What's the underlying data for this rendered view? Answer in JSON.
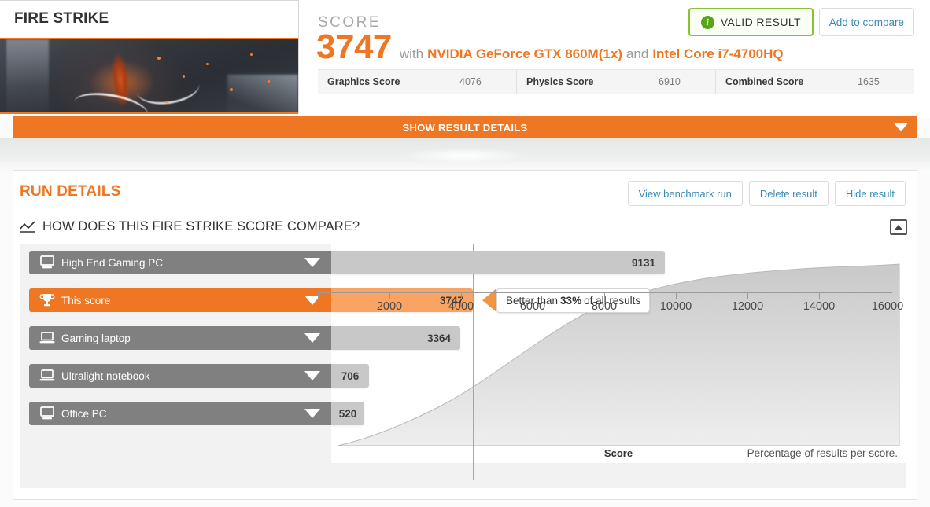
{
  "benchmark": {
    "title": "FIRE STRIKE"
  },
  "score_panel": {
    "label": "SCORE",
    "value": "3747",
    "with_word": "with",
    "gpu": "NVIDIA GeForce GTX 860M(1x)",
    "and_word": "and",
    "cpu": "Intel Core i7-4700HQ",
    "subscores": [
      {
        "name": "Graphics Score",
        "value": "4076"
      },
      {
        "name": "Physics Score",
        "value": "6910"
      },
      {
        "name": "Combined Score",
        "value": "1635"
      }
    ],
    "valid_button": "VALID RESULT",
    "valid_icon": "info-circle-icon",
    "compare_button": "Add to compare"
  },
  "show_details_bar": {
    "label": "SHOW RESULT DETAILS",
    "icon": "chevron-down-icon"
  },
  "run_details": {
    "title": "RUN DETAILS",
    "buttons": [
      {
        "label": "View benchmark run"
      },
      {
        "label": "Delete result"
      },
      {
        "label": "Hide result"
      }
    ],
    "compare_heading": "HOW DOES THIS FIRE STRIKE SCORE COMPARE?",
    "compare_icon": "line-chart-icon",
    "collapse_icon": "chevron-up-icon"
  },
  "tooltip": {
    "prefix": "Better than ",
    "percent": "33%",
    "suffix": " of all results"
  },
  "chart_data": {
    "type": "bar",
    "title": "HOW DOES THIS FIRE STRIKE SCORE COMPARE?",
    "xlabel": "Score",
    "ylabel": "",
    "xlim": [
      0,
      16000
    ],
    "xticks": [
      2000,
      4000,
      6000,
      8000,
      10000,
      12000,
      14000,
      16000
    ],
    "grid": false,
    "annotation": "Percentage of results per score.",
    "categories": [
      "High End Gaming PC",
      "This score",
      "Gaming laptop",
      "Ultralight notebook",
      "Office PC"
    ],
    "values": [
      9131,
      3747,
      3364,
      706,
      520
    ],
    "icons": [
      "desktop-icon",
      "trophy-icon",
      "laptop-icon",
      "laptop-icon",
      "desktop-icon"
    ],
    "highlight_index": 1,
    "marker_value": 3747,
    "percentile": 33,
    "overlay": {
      "type": "area",
      "name": "Percentage of results per score",
      "x": [
        0,
        1000,
        2000,
        3000,
        4000,
        5000,
        6000,
        7000,
        8000,
        9000,
        10000,
        11000,
        12000,
        13000,
        14000,
        15000,
        16000
      ],
      "y": [
        0,
        3,
        9,
        19,
        33,
        48,
        62,
        74,
        83,
        89,
        93,
        96,
        97.5,
        98.5,
        99.2,
        99.7,
        100
      ]
    }
  },
  "colors": {
    "accent_orange": "#ef7622",
    "light_orange": "#f9a463",
    "bar_gray": "#808080",
    "value_gray": "#c8c8c8",
    "valid_green": "#86c232",
    "link_blue": "#3b8ab5"
  }
}
